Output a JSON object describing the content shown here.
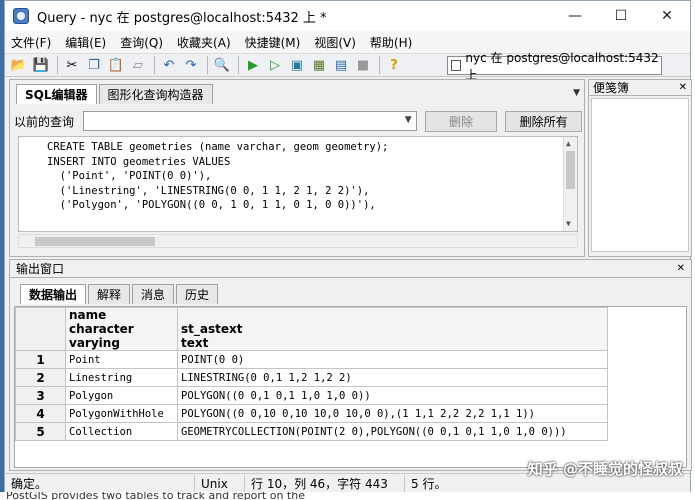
{
  "window": {
    "title": "Query - nyc 在  postgres@localhost:5432 上 *",
    "controls": [
      "—",
      "☐",
      "✕"
    ]
  },
  "menu": [
    "文件(F)",
    "编辑(E)",
    "查询(Q)",
    "收藏夹(A)",
    "快捷键(M)",
    "视图(V)",
    "帮助(H)"
  ],
  "toolbar": {
    "connection": "nyc 在  postgres@localhost:5432 上"
  },
  "editor": {
    "tabs": [
      "SQL编辑器",
      "图形化查询构造器"
    ],
    "prev_query_label": "以前的查询",
    "delete_label": "删除",
    "delete_all_label": "删除所有",
    "sql_lines": [
      "CREATE TABLE geometries (name varchar, geom geometry);",
      "",
      "INSERT INTO geometries VALUES",
      "  ('Point', 'POINT(0 0)'),",
      "  ('Linestring', 'LINESTRING(0 0, 1 1, 2 1, 2 2)'),",
      "  ('Polygon', 'POLYGON((0 0, 1 0, 1 1, 0 1, 0 0))'),"
    ]
  },
  "scratch": {
    "title": "便笺簿"
  },
  "output": {
    "title": "输出窗口",
    "tabs": [
      "数据输出",
      "解释",
      "消息",
      "历史"
    ],
    "columns": [
      {
        "name": "name",
        "type": "character varying"
      },
      {
        "name": "st_astext",
        "type": "text"
      }
    ],
    "rows": [
      {
        "num": "1",
        "name": "Point",
        "text": "POINT(0 0)"
      },
      {
        "num": "2",
        "name": "Linestring",
        "text": "LINESTRING(0 0,1 1,2 1,2 2)"
      },
      {
        "num": "3",
        "name": "Polygon",
        "text": "POLYGON((0 0,1 0,1 1,0 1,0 0))"
      },
      {
        "num": "4",
        "name": "PolygonWithHole",
        "text": "POLYGON((0 0,10 0,10 10,0 10,0 0),(1 1,1 2,2 2,2 1,1 1))"
      },
      {
        "num": "5",
        "name": "Collection",
        "text": "GEOMETRYCOLLECTION(POINT(2 0),POLYGON((0 0,1 0,1 1,0 1,0 0)))"
      }
    ]
  },
  "status": {
    "ready": "确定。",
    "eol": "Unix",
    "position": "行 10，列 46，字符 443",
    "rows": "5 行。"
  },
  "watermark": "知乎 @不睡觉的怪叔叔",
  "footer_text": "PostGIS provides two tables to track and report on the"
}
